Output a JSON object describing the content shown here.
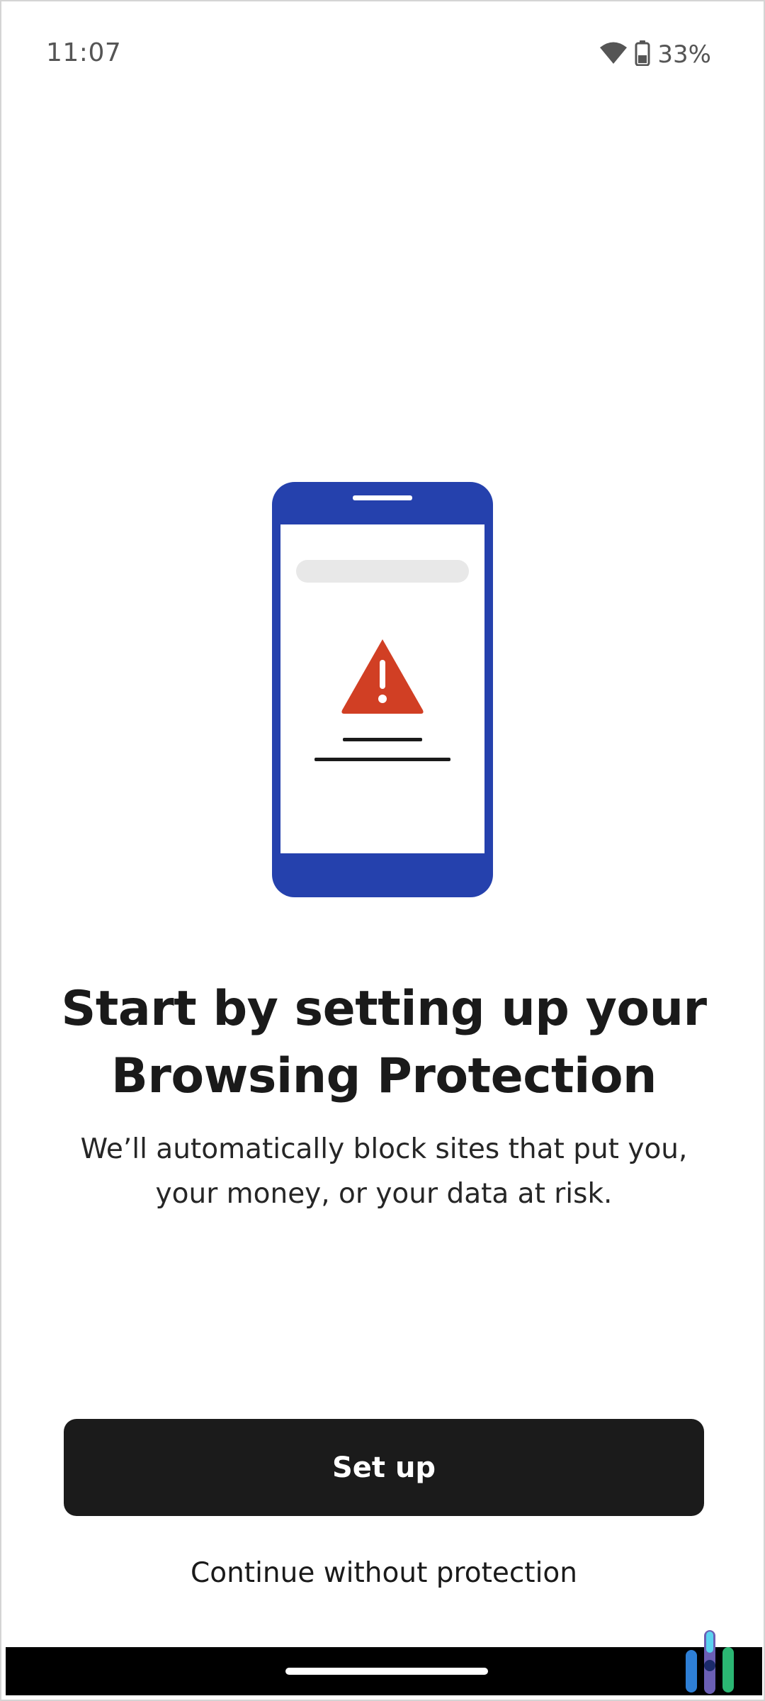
{
  "status_bar": {
    "time": "11:07",
    "battery_percent": "33%",
    "icons": [
      "wifi-icon",
      "battery-icon"
    ]
  },
  "illustration": {
    "description_icons": [
      "phone-icon",
      "warning-icon"
    ],
    "colors": {
      "phone_body": "#2541AD",
      "screen": "#FFFFFF",
      "url_bar": "#E8E8E8",
      "warning": "#D13F24",
      "text_lines": "#1A1A1A"
    }
  },
  "content": {
    "headline": "Start by setting up your Browsing Protection",
    "description": "We’ll automatically block sites that put you, your money, or your data at risk."
  },
  "actions": {
    "primary_label": "Set up",
    "secondary_label": "Continue without protection"
  },
  "colors": {
    "primary_button_bg": "#1B1B1B",
    "primary_button_text": "#FFFFFF",
    "background": "#FFFFFF",
    "nav_bar": "#000000"
  }
}
